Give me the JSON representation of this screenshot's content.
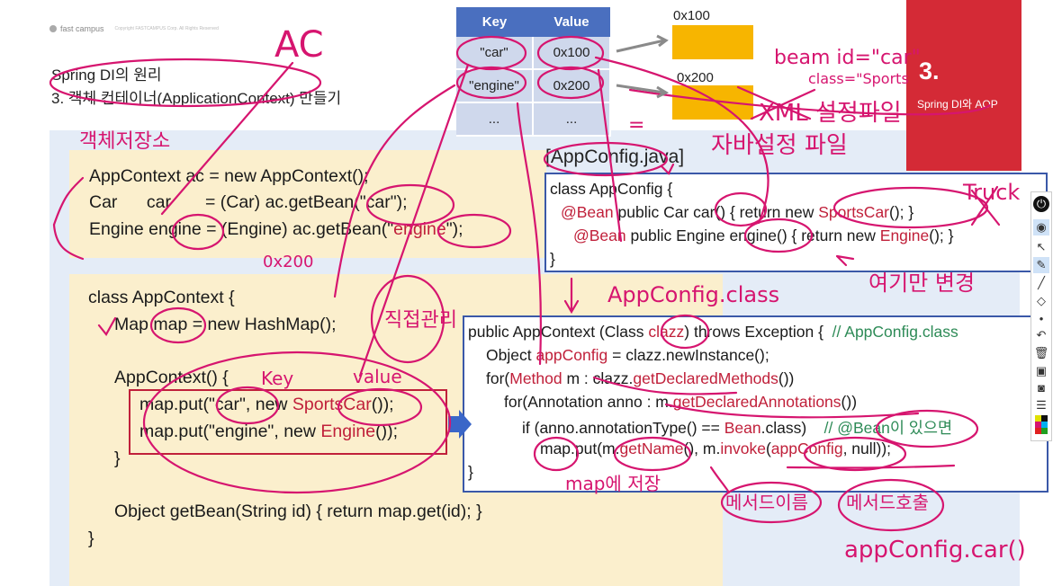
{
  "logo": {
    "brand": "fast campus",
    "copyright": "Copyright FASTCAMPUS Corp. All Rights Reserved"
  },
  "slide": {
    "title1": "Spring DI의 원리",
    "title2": "3. 객체 컨테이너(ApplicationContext) 만들기"
  },
  "chapter": {
    "number": "3.",
    "subtitle": "Spring DI와 AOP"
  },
  "kv_table": {
    "headers": [
      "Key",
      "Value"
    ],
    "rows": [
      [
        "\"car\"",
        "0x100"
      ],
      [
        "\"engine\"",
        "0x200"
      ],
      [
        "...",
        "..."
      ]
    ]
  },
  "memory": {
    "addr1": "0x100",
    "addr2": "0x200"
  },
  "box1": {
    "l1": "AppContext ac = new AppContext();",
    "l2a": "Car      car       = (Car) ac.getBean(\"",
    "l2b": "car",
    "l2c": "\");",
    "l3a": "Engine engine = (Engine) ac.getBean(\"",
    "l3b": "engine",
    "l3c": "\");"
  },
  "box2": {
    "l1": "class AppContext {",
    "l2": "Map map = new HashMap();",
    "l3": "AppContext() {",
    "l4a": "map.put(\"car\", new ",
    "l4b": "SportsCar",
    "l4c": "());",
    "l5a": "map.put(\"engine\", new ",
    "l5b": "Engine",
    "l5c": "());",
    "l6": "}",
    "l7": "Object getBean(String id) { return map.get(id); }",
    "l8": "}"
  },
  "appconfig": {
    "file": "[AppConfig.java]",
    "l1": "class AppConfig {",
    "l2a": "@Bean",
    "l2b": " public Car car() { return new ",
    "l2c": "SportsCar",
    "l2d": "(); }",
    "l3a": "@Bean",
    "l3b": " public Engine engine() { return new ",
    "l3c": "Engine",
    "l3d": "(); }",
    "l4": "}"
  },
  "ctor": {
    "l1a": "public AppContext (Class ",
    "l1b": "clazz",
    "l1c": ") throws Exception {  ",
    "l1d": "// AppConfig.class",
    "l2a": "Object ",
    "l2b": "appConfig",
    "l2c": " = clazz.newInstance();",
    "l3a": "for(",
    "l3b": "Method",
    "l3c": " m : clazz.",
    "l3d": "getDeclaredMethods",
    "l3e": "())",
    "l4a": "for(Annotation anno : m.",
    "l4b": "getDeclaredAnnotations",
    "l4c": "())",
    "l5a": "if (anno.annotationType() == ",
    "l5b": "Bean",
    "l5c": ".class)    ",
    "l5d": "// @Bean이 있으면",
    "l6a": "map.put(m.",
    "l6b": "getName",
    "l6c": "(), m.",
    "l6d": "invoke",
    "l6e": "(",
    "l6f": "appConfig",
    "l6g": ", null));",
    "l7": "}"
  },
  "handwriting": {
    "ac": "AC",
    "store": "객체저장소",
    "beanid": "beam id=\"car\"",
    "class": "class=\"Sports",
    "xml": "XML 설정파일",
    "java": "자바설정 파일",
    "truck": "Truck",
    "hex": "0x200",
    "key": "Key",
    "value": "value",
    "direct": "직접관리",
    "appconfigclass": "AppConfig.class",
    "change": "여기만 변경",
    "mapstore": "map에 저장",
    "methodname": "메서드이름",
    "call": "메서드호출",
    "appconfigcar": "appConfig.car()",
    "equal": "="
  },
  "colors": {
    "accent_red": "#d42a36",
    "ink": "#d6156f",
    "code_red": "#c0203a",
    "box_blue": "#3a58a8"
  }
}
